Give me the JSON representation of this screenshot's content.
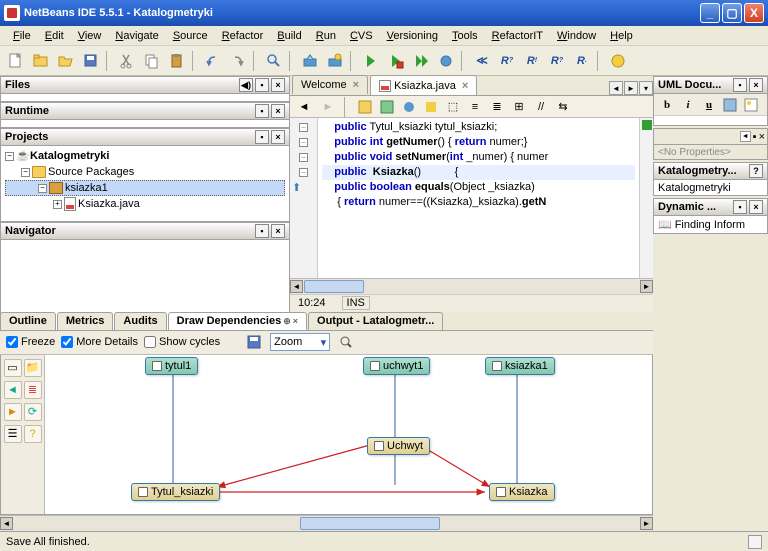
{
  "window": {
    "title": "NetBeans IDE 5.5.1 - Katalogmetryki"
  },
  "menu": [
    "File",
    "Edit",
    "View",
    "Navigate",
    "Source",
    "Refactor",
    "Build",
    "Run",
    "CVS",
    "Versioning",
    "Tools",
    "RefactorIT",
    "Window",
    "Help"
  ],
  "left": {
    "files": {
      "title": "Files"
    },
    "runtime": {
      "title": "Runtime"
    },
    "projects": {
      "title": "Projects",
      "root": "Katalogmetryki",
      "srcpkg": "Source Packages",
      "pkg": "ksiazka1",
      "file": "Ksiazka.java"
    },
    "navigator": {
      "title": "Navigator"
    }
  },
  "editor": {
    "tabs": [
      {
        "label": "Welcome",
        "active": false,
        "closable": true
      },
      {
        "label": "Ksiazka.java",
        "active": true,
        "closable": true
      }
    ],
    "lines": [
      {
        "type": "code",
        "text": [
          "    ",
          [
            "kw",
            "public"
          ],
          " Tytul_ksiazki tytul_ksiazki;"
        ]
      },
      {
        "type": "code",
        "text": [
          "    ",
          [
            "kw",
            "public"
          ],
          " ",
          [
            "kw",
            "int"
          ],
          " ",
          [
            "fn",
            "getNumer"
          ],
          "() { ",
          [
            "kw",
            "return"
          ],
          " numer;}"
        ]
      },
      {
        "type": "code",
        "text": [
          "    ",
          [
            "kw",
            "public"
          ],
          " ",
          [
            "kw",
            "void"
          ],
          " ",
          [
            "fn",
            "setNumer"
          ],
          "(",
          [
            "kw",
            "int"
          ],
          " _numer) { numer"
        ]
      },
      {
        "type": "code",
        "text": [
          "    ",
          [
            "kw",
            "public"
          ],
          "  ",
          [
            "fn",
            "Ksiazka"
          ],
          "()           {"
        ]
      },
      {
        "type": "code",
        "text": [
          "    ",
          [
            "kw",
            "public"
          ],
          " ",
          [
            "kw",
            "boolean"
          ],
          " ",
          [
            "fn",
            "equals"
          ],
          "(Object _ksiazka)"
        ]
      },
      {
        "type": "code",
        "text": [
          "     { ",
          [
            "kw",
            "return"
          ],
          " numer==((Ksiazka)_ksiazka).",
          [
            "fn",
            "getN"
          ]
        ]
      }
    ],
    "status": {
      "pos": "10:24",
      "mode": "INS"
    }
  },
  "inspector": {
    "tabs": [
      "Outline",
      "Metrics",
      "Audits",
      "Draw Dependencies",
      "Output - Latalogmetr..."
    ],
    "active": 3,
    "toolbar": {
      "freeze": "Freeze",
      "moredetails": "More Details",
      "showcycles": "Show cycles",
      "zoom": "Zoom"
    },
    "nodes": {
      "tytul1": "tytul1",
      "uchwyt1": "uchwyt1",
      "ksiazka1": "ksiazka1",
      "Tytul_ksiazki": "Tytul_ksiazki",
      "Uchwyt": "Uchwyt",
      "Ksiazka": "Ksiazka"
    }
  },
  "right": {
    "uml": {
      "title": "UML Docu...",
      "noprops": "<No Properties>"
    },
    "proj": {
      "title": "Katalogmetry...",
      "sub": "Katalogmetryki"
    },
    "dyn": {
      "title": "Dynamic ...",
      "finding": "Finding Inform"
    }
  },
  "status": {
    "text": "Save All finished."
  }
}
